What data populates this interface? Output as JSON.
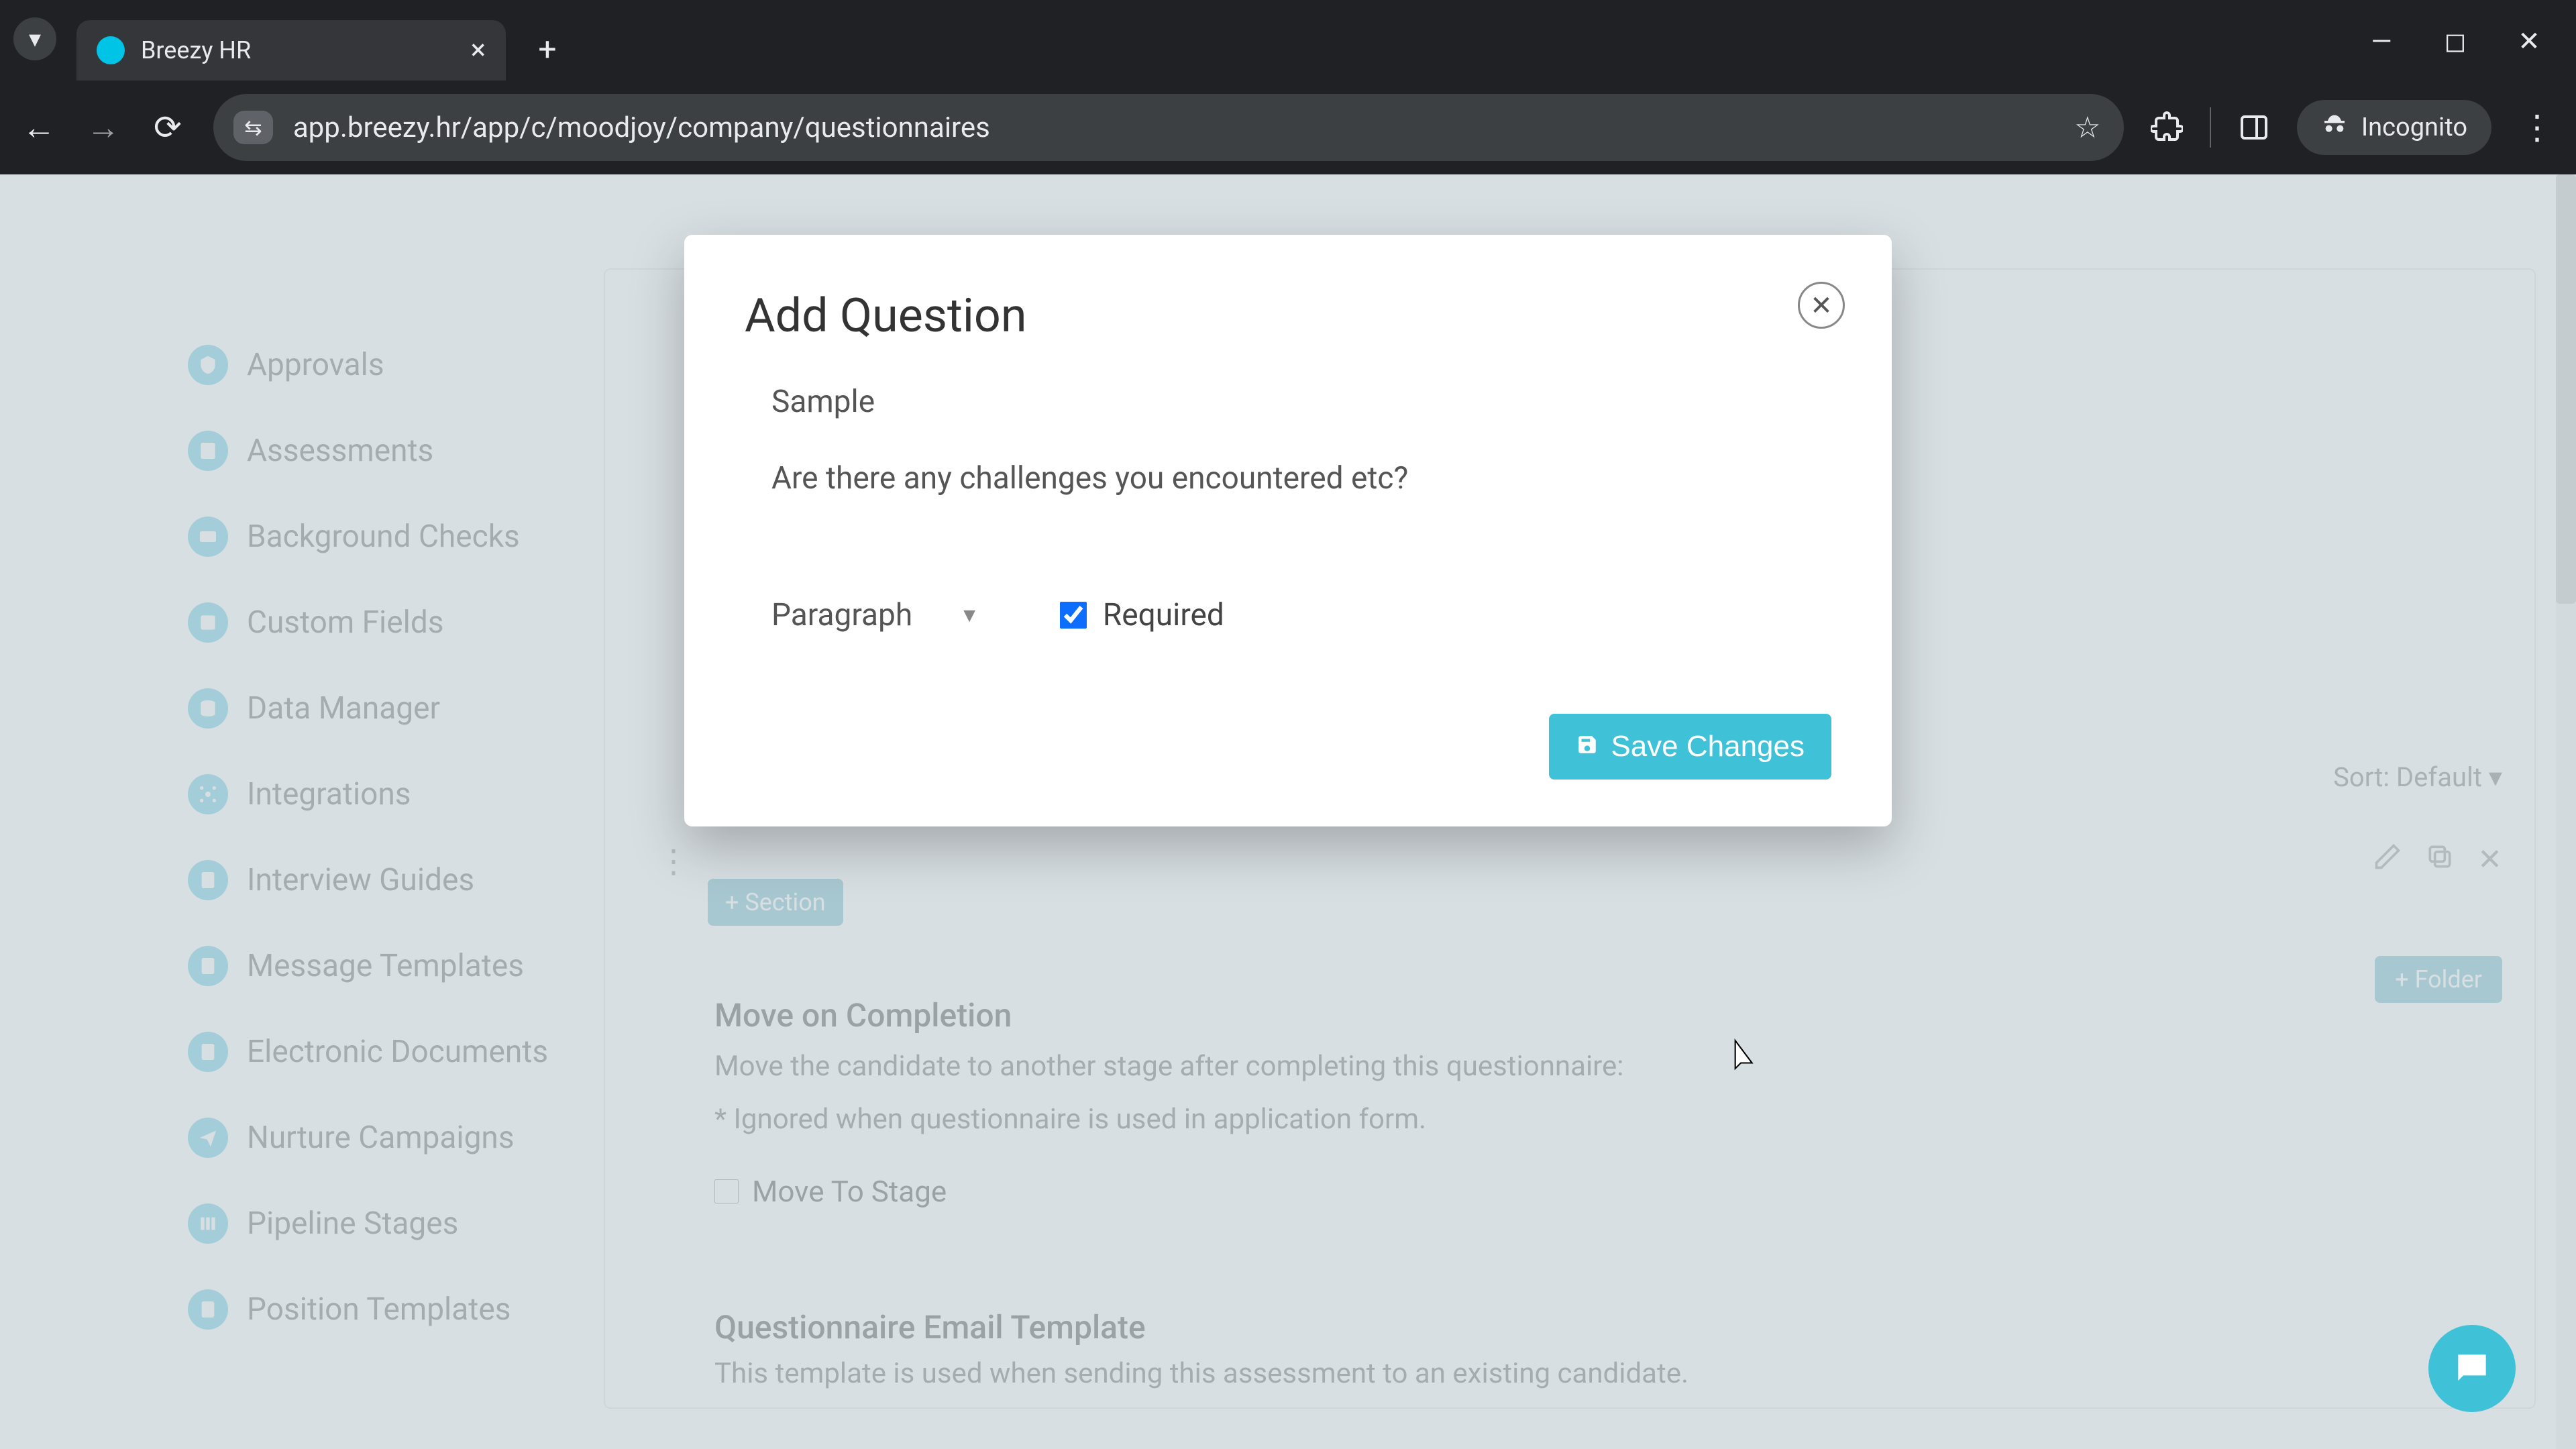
{
  "browser": {
    "tab_title": "Breezy HR",
    "url": "app.breezy.hr/app/c/moodjoy/company/questionnaires",
    "incognito_label": "Incognito"
  },
  "sidebar": {
    "items": [
      {
        "label": "Approvals"
      },
      {
        "label": "Assessments"
      },
      {
        "label": "Background Checks"
      },
      {
        "label": "Custom Fields"
      },
      {
        "label": "Data Manager"
      },
      {
        "label": "Integrations"
      },
      {
        "label": "Interview Guides"
      },
      {
        "label": "Message Templates"
      },
      {
        "label": "Electronic Documents"
      },
      {
        "label": "Nurture Campaigns"
      },
      {
        "label": "Pipeline Stages"
      },
      {
        "label": "Position Templates"
      }
    ]
  },
  "page": {
    "sort_label": "Sort: Default",
    "section_btn": "Section",
    "folder_btn": "Folder",
    "move": {
      "title": "Move on Completion",
      "desc": "Move the candidate to another stage after completing this questionnaire:",
      "note": "* Ignored when questionnaire is used in application form.",
      "checkbox_label": "Move To Stage"
    },
    "email": {
      "title": "Questionnaire Email Template",
      "desc": "This template is used when sending this assessment to an existing candidate."
    }
  },
  "modal": {
    "title": "Add Question",
    "sample_label": "Sample",
    "question_text": "Are there any challenges you encountered etc?",
    "type_value": "Paragraph",
    "required_label": "Required",
    "required_checked": true,
    "save_label": "Save Changes"
  }
}
